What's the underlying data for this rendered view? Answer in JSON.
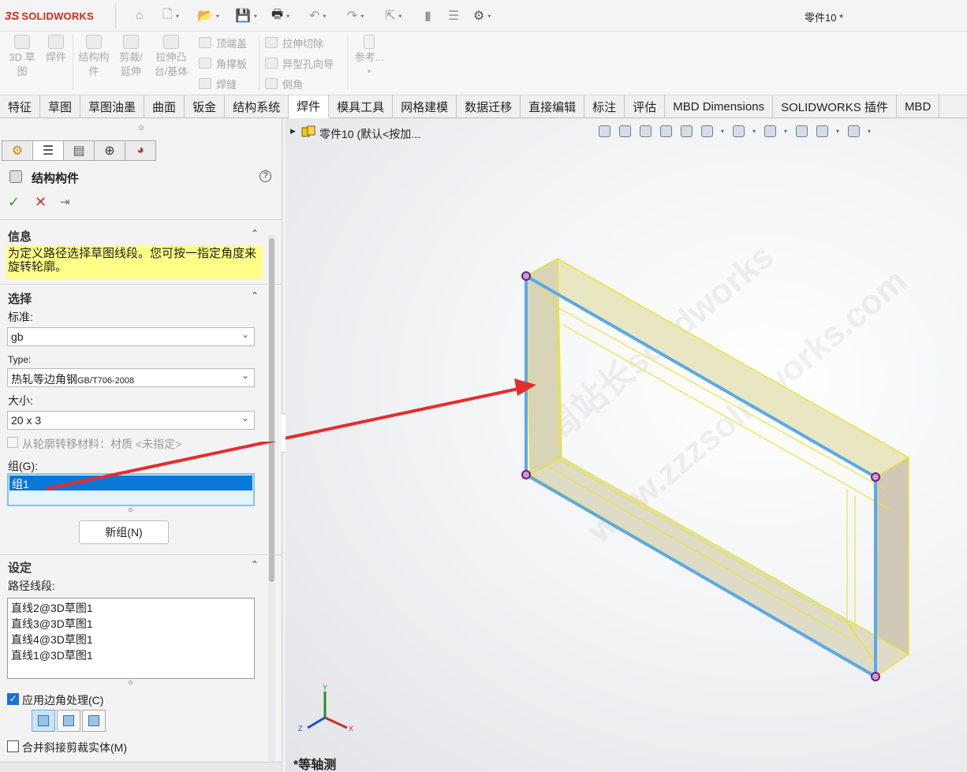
{
  "app": {
    "logo_ds": "3S",
    "logo_name": "SOLIDWORKS",
    "document_title": "零件10 *"
  },
  "command_manager": {
    "big_buttons": [
      {
        "label": "3D 草\n图"
      },
      {
        "label": "焊件"
      },
      {
        "label": "结构构\n件"
      },
      {
        "label": "剪裁/\n延伸"
      },
      {
        "label": "拉伸凸\n台/基体"
      }
    ],
    "small_buttons_col1": [
      "顶端盖",
      "角撑板",
      "焊缝"
    ],
    "small_buttons_col2": [
      "拉伸切除",
      "异型孔向导",
      "倒角"
    ],
    "reference": "参考..."
  },
  "tabs": [
    "特征",
    "草图",
    "草图油墨",
    "曲面",
    "钣金",
    "结构系统",
    "焊件",
    "模具工具",
    "网格建模",
    "数据迁移",
    "直接编辑",
    "标注",
    "评估",
    "MBD Dimensions",
    "SOLIDWORKS 插件",
    "MBD"
  ],
  "active_tab": "焊件",
  "property_manager": {
    "title": "结构构件",
    "help": "?",
    "ok": "✓",
    "cancel": "✕",
    "pin": "⇥",
    "info": {
      "header": "信息",
      "message": "为定义路径选择草图线段。您可按一指定角度来旋转轮廓。"
    },
    "selection": {
      "header": "选择",
      "standard_label": "标准:",
      "standard_value": "gb",
      "type_label": "Type:",
      "type_value_main": "热轧等边角钢",
      "type_value_suffix": "GB/T706-2008",
      "size_label": "大小:",
      "size_value": "20 x 3",
      "transfer_material": "从轮廓转移材料：材质 <未指定>",
      "group_label": "组(G):",
      "group_item": "组1",
      "new_group": "新组(N)"
    },
    "settings": {
      "header": "设定",
      "path_label": "路径线段:",
      "path_segments": [
        "直线2@3D草图1",
        "直线3@3D草图1",
        "直线4@3D草图1",
        "直线1@3D草图1"
      ],
      "apply_corner": "应用边角处理(C)",
      "apply_corner_checked": true,
      "merge_miter": "合并斜接剪裁实体(M)",
      "merge_miter_checked": false
    }
  },
  "graphics": {
    "tree_text": "零件10 (默认<按加...",
    "view_name": "*等轴测",
    "triad": {
      "x": "X",
      "y": "Y",
      "z": "Z"
    },
    "watermark_1": "周站长solidworks",
    "watermark_2": "www.zzzsolidworks.com"
  },
  "colors": {
    "accent": "#0a78d7",
    "highlight_yellow": "#ffff88",
    "sketch_blue": "#5aa9e6",
    "member_yellow": "#f2f24a",
    "arrow_red": "#e52d2d"
  }
}
